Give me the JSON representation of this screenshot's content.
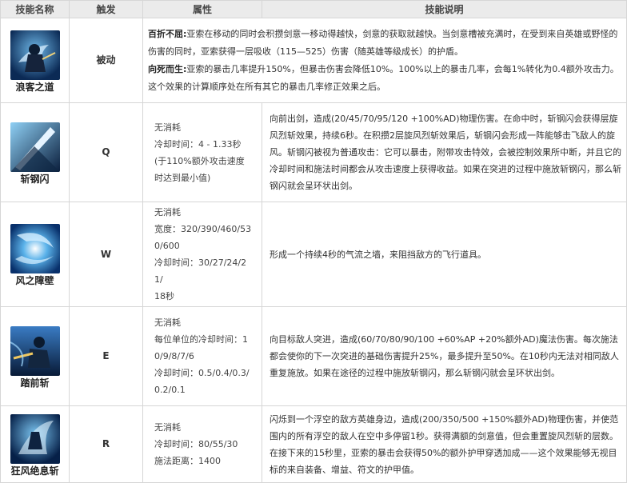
{
  "headers": {
    "name": "技能名称",
    "key": "触发",
    "attr": "属性",
    "desc": "技能说明"
  },
  "passive": {
    "name": "浪客之道",
    "key": "被动",
    "desc1_bold": "百折不屈:",
    "desc1": "亚索在移动的同时会积攒剑意一移动得越快，剑意的获取就越快。当剑意槽被充满时，在受到来自英雄或野怪的伤害的同时，亚索获得一层吸收（115—525）伤害（随英雄等级成长）的护盾。",
    "desc2_bold": "向死而生:",
    "desc2": "亚索的暴击几率提升150%，但暴击伤害会降低10%。100%以上的暴击几率，会每1%转化为0.4额外攻击力。这个效果的计算顺序处在所有其它的暴击几率修正效果之后。"
  },
  "q": {
    "name": "斩钢闪",
    "key": "Q",
    "attr_lines": [
      "无消耗",
      "冷却时间：4 - 1.33秒",
      "(于110%额外攻击速度",
      "时达到最小值)"
    ],
    "desc": "向前出剑，造成(20/45/70/95/120 +100%AD)物理伤害。在命中时，斩钢闪会获得层旋风烈斩效果，持续6秒。在积攒2层旋风烈斩效果后，斩钢闪会形成一阵能够击飞敌人的旋风。斩钢闪被视为普通攻击：它可以暴击，附带攻击特效，会被控制效果所中断，并且它的冷却时间和施法时间都会从攻击速度上获得收益。如果在突进的过程中施放斩钢闪，那么斩钢闪就会呈环状出剑。"
  },
  "w": {
    "name": "风之障壁",
    "key": "W",
    "attr_lines": [
      "无消耗",
      "宽度：320/390/460/53",
      "0/600",
      "冷却时间：30/27/24/21/",
      "18秒"
    ],
    "desc": "形成一个持续4秒的气流之墙，来阻挡敌方的飞行道具。"
  },
  "e": {
    "name": "踏前斩",
    "key": "E",
    "attr_lines": [
      "无消耗",
      "每位单位的冷却时间：1",
      "0/9/8/7/6",
      "冷却时间：0.5/0.4/0.3/",
      "0.2/0.1"
    ],
    "desc": "向目标敌人突进，造成(60/70/80/90/100 +60%AP +20%额外AD)魔法伤害。每次施法都会使你的下一次突进的基础伤害提升25%，最多提升至50%。在10秒内无法对相同敌人重复施放。如果在途径的过程中施放斩钢闪，那么斩钢闪就会呈环状出剑。"
  },
  "r": {
    "name": "狂风绝息斩",
    "key": "R",
    "attr_lines": [
      "无消耗",
      "冷却时间：80/55/30",
      "施法距离：1400"
    ],
    "desc": "闪烁到一个浮空的敌方英雄身边，造成(200/350/500 +150%额外AD)物理伤害，并使范围内的所有浮空的敌人在空中多停留1秒。获得满额的剑意值，但会重置旋风烈斩的层数。在接下来的15秒里，亚索的暴击会获得50%的额外护甲穿透加成——这个效果能够无视目标的来自装备、增益、符文的护甲值。"
  }
}
